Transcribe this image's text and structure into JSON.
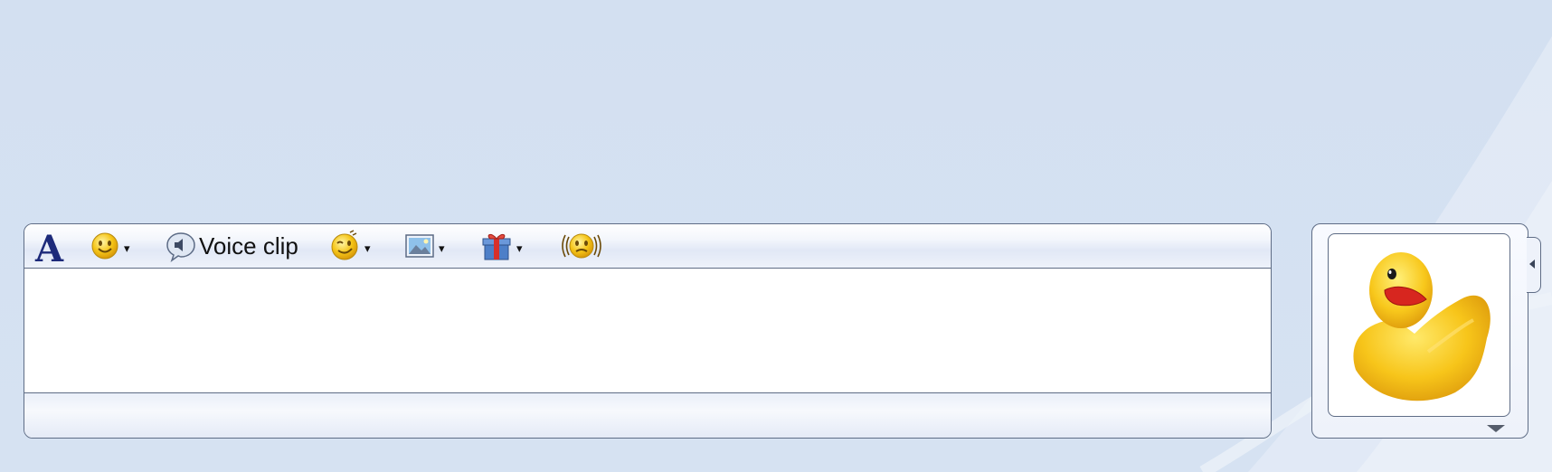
{
  "toolbar": {
    "font_icon": "font-icon",
    "font_glyph": "A",
    "emoticon_icon": "smiley-icon",
    "voice_clip_label": "Voice clip",
    "voice_icon": "speaker-bubble-icon",
    "wink_icon": "wink-icon",
    "background_icon": "picture-icon",
    "gift_icon": "gift-icon",
    "nudge_icon": "nudge-icon",
    "dropdown_glyph": "▾"
  },
  "message_input": {
    "value": ""
  },
  "display_picture": {
    "icon": "rubber-duck-avatar"
  },
  "colors": {
    "background": "#d3e0f1",
    "border": "#5f6d86",
    "font_icon": "#1d2a7a",
    "duck_yellow": "#f7c51a",
    "duck_beak": "#d7261f"
  }
}
